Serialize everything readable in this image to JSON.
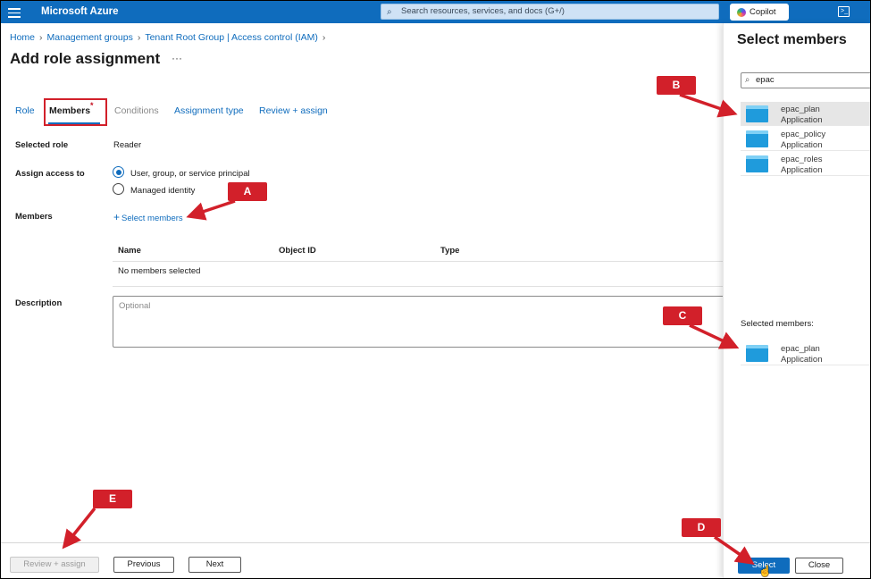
{
  "topbar": {
    "brand": "Microsoft Azure",
    "search_placeholder": "Search resources, services, and docs (G+/)",
    "copilot_label": "Copilot"
  },
  "breadcrumb": [
    "Home",
    "Management groups",
    "Tenant Root Group | Access control (IAM)"
  ],
  "page": {
    "title": "Add role assignment",
    "more": "···"
  },
  "tabs": [
    "Role",
    "Members",
    "Conditions",
    "Assignment type",
    "Review + assign"
  ],
  "form": {
    "selected_role_label": "Selected role",
    "selected_role_value": "Reader",
    "assign_access_label": "Assign access to",
    "option_users": "User, group, or service principal",
    "option_managed": "Managed identity",
    "members_label": "Members",
    "select_members_link": "Select members",
    "table_headers": [
      "Name",
      "Object ID",
      "Type"
    ],
    "empty_row": "No members selected",
    "description_label": "Description",
    "description_placeholder": "Optional"
  },
  "footer": {
    "review_assign": "Review + assign",
    "previous": "Previous",
    "next": "Next"
  },
  "panel": {
    "title": "Select members",
    "search_value": "epac",
    "results": [
      {
        "name": "epac_plan",
        "type": "Application"
      },
      {
        "name": "epac_policy",
        "type": "Application"
      },
      {
        "name": "epac_roles",
        "type": "Application"
      }
    ],
    "selected_label": "Selected members:",
    "selected": [
      {
        "name": "epac_plan",
        "type": "Application"
      }
    ],
    "select_button": "Select",
    "close_button": "Close"
  },
  "callouts": [
    "A",
    "B",
    "C",
    "D",
    "E"
  ],
  "colors": {
    "azure_blue": "#0f6cbd",
    "callout_red": "#d2202a"
  },
  "icons": [
    "hamburger-icon",
    "search-icon",
    "copilot-icon",
    "cloud-shell-icon",
    "app-registration-icon",
    "pointer-cursor-icon"
  ]
}
